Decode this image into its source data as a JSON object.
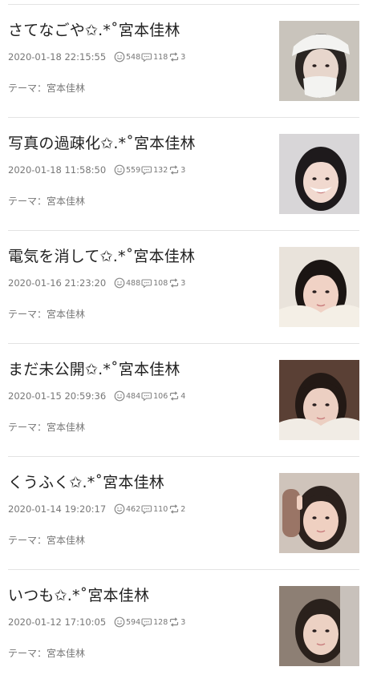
{
  "theme_prefix": "テーマ：",
  "entries": [
    {
      "title": "さてなごや✩.*˚宮本佳林",
      "date": "2020-01-18 22:15:55",
      "likes": "548",
      "comments": "118",
      "reblogs": "3",
      "theme": "宮本佳林",
      "thumb": {
        "bg": "#c9c4bc",
        "hair": "#2a2522",
        "skin": "#e7d6cc",
        "accent": "#f3f3f1",
        "accent_kind": "hat-mask"
      }
    },
    {
      "title": "写真の過疎化✩.*˚宮本佳林",
      "date": "2020-01-18 11:58:50",
      "likes": "559",
      "comments": "132",
      "reblogs": "3",
      "theme": "宮本佳林",
      "thumb": {
        "bg": "#d8d6d8",
        "hair": "#1e1a1c",
        "skin": "#f1d9cf",
        "accent": "#ffffff",
        "accent_kind": "smile"
      }
    },
    {
      "title": "電気を消して✩.*˚宮本佳林",
      "date": "2020-01-16 21:23:20",
      "likes": "488",
      "comments": "108",
      "reblogs": "3",
      "theme": "宮本佳林",
      "thumb": {
        "bg": "#e9e3db",
        "hair": "#1b1513",
        "skin": "#f0d2c5",
        "accent": "#f4efe6",
        "accent_kind": "fur"
      }
    },
    {
      "title": "まだ未公開✩.*˚宮本佳林",
      "date": "2020-01-15 20:59:36",
      "likes": "484",
      "comments": "106",
      "reblogs": "4",
      "theme": "宮本佳林",
      "thumb": {
        "bg": "#5a4035",
        "hair": "#231915",
        "skin": "#eccfc2",
        "accent": "#f1ece5",
        "accent_kind": "fur"
      }
    },
    {
      "title": "くうふく✩.*˚宮本佳林",
      "date": "2020-01-14 19:20:17",
      "likes": "462",
      "comments": "110",
      "reblogs": "2",
      "theme": "宮本佳林",
      "thumb": {
        "bg": "#cfc4bb",
        "hair": "#2b211d",
        "skin": "#efd0c1",
        "accent": "#9a7566",
        "accent_kind": "peace"
      }
    },
    {
      "title": "いつも✩.*˚宮本佳林",
      "date": "2020-01-12 17:10:05",
      "likes": "594",
      "comments": "128",
      "reblogs": "3",
      "theme": "宮本佳林",
      "thumb": {
        "bg": "#8d7f74",
        "hair": "#2a211c",
        "skin": "#ecd1c3",
        "accent": "#c8c1bb",
        "accent_kind": "side"
      }
    }
  ]
}
